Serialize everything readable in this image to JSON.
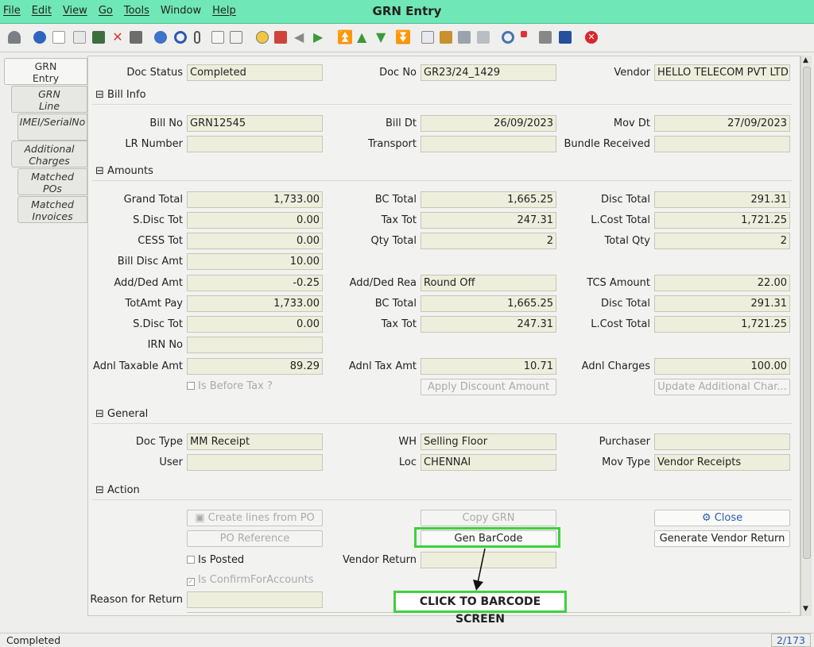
{
  "window": {
    "title": "GRN Entry"
  },
  "menu": [
    "File",
    "Edit",
    "View",
    "Go",
    "Tools",
    "Window",
    "Help"
  ],
  "toolbar_icons": [
    "undo-icon",
    "help-icon",
    "new-icon",
    "copy-icon",
    "save-new-icon",
    "delete-icon",
    "save-icon",
    "refresh-icon",
    "find-icon",
    "attach-icon",
    "chat-icon",
    "history-icon",
    "home-icon",
    "home-alt-icon",
    "back-icon",
    "forward-icon",
    "first-icon",
    "previous-icon",
    "next-icon",
    "last-icon",
    "report-icon",
    "archive-icon",
    "print-preview-icon",
    "print-icon",
    "zoom-across-icon",
    "workflow-icon",
    "request-icon",
    "product-info-icon",
    "exit-icon"
  ],
  "tabs": [
    {
      "label": "GRN\nEntry"
    },
    {
      "label": "GRN\nLine"
    },
    {
      "label": "IMEI/SerialNo"
    },
    {
      "label": "Additional\nCharges"
    },
    {
      "label": "Matched\nPOs"
    },
    {
      "label": "Matched\nInvoices"
    }
  ],
  "header": {
    "doc_status_label": "Doc Status",
    "doc_status": "Completed",
    "doc_no_label": "Doc No",
    "doc_no": "GR23/24_1429",
    "vendor_label": "Vendor",
    "vendor": "HELLO TELECOM PVT LTD"
  },
  "bill_info": {
    "section": "Bill Info",
    "bill_no_label": "Bill No",
    "bill_no": "GRN12545",
    "bill_dt_label": "Bill Dt",
    "bill_dt": "26/09/2023",
    "mov_dt_label": "Mov Dt",
    "mov_dt": "27/09/2023",
    "lr_label": "LR Number",
    "lr": "",
    "transport_label": "Transport",
    "transport": "",
    "bundle_label": "Bundle Received",
    "bundle": ""
  },
  "amounts": {
    "section": "Amounts",
    "grand_total_label": "Grand Total",
    "grand_total": "1,733.00",
    "bc_total_label": "BC Total",
    "bc_total": "1,665.25",
    "disc_total_label": "Disc Total",
    "disc_total": "291.31",
    "sdisc_tot_label": "S.Disc Tot",
    "sdisc_tot": "0.00",
    "tax_tot_label": "Tax Tot",
    "tax_tot": "247.31",
    "lcost_total_label": "L.Cost Total",
    "lcost_total": "1,721.25",
    "cess_tot_label": "CESS Tot",
    "cess_tot": "0.00",
    "qty_total_label": "Qty Total",
    "qty_total": "2",
    "total_qty_label": "Total Qty",
    "total_qty": "2",
    "bill_disc_amt_label": "Bill Disc Amt",
    "bill_disc_amt": "10.00",
    "add_ded_amt_label": "Add/Ded Amt",
    "add_ded_amt": "-0.25",
    "add_ded_rea_label": "Add/Ded Rea",
    "add_ded_rea": "Round Off",
    "tcs_amount_label": "TCS Amount",
    "tcs_amount": "22.00",
    "totamt_pay_label": "TotAmt Pay",
    "totamt_pay": "1,733.00",
    "bc_total2_label": "BC Total",
    "bc_total2": "1,665.25",
    "disc_total2_label": "Disc Total",
    "disc_total2": "291.31",
    "sdisc_tot2_label": "S.Disc Tot",
    "sdisc_tot2": "0.00",
    "tax_tot2_label": "Tax Tot",
    "tax_tot2": "247.31",
    "lcost_total2_label": "L.Cost Total",
    "lcost_total2": "1,721.25",
    "irn_no_label": "IRN No",
    "irn_no": "",
    "adnl_taxable_label": "Adnl Taxable Amt",
    "adnl_taxable": "89.29",
    "adnl_tax_label": "Adnl Tax Amt",
    "adnl_tax": "10.71",
    "adnl_charges_label": "Adnl Charges",
    "adnl_charges": "100.00",
    "is_before_tax_label": "Is Before Tax ?",
    "apply_discount_label": "Apply Discount Amount",
    "update_additional_label": "Update Additional Char..."
  },
  "general": {
    "section": "General",
    "doc_type_label": "Doc Type",
    "doc_type": "MM Receipt",
    "wh_label": "WH",
    "wh": "Selling Floor",
    "purchaser_label": "Purchaser",
    "purchaser": "",
    "user_label": "User",
    "user": "",
    "loc_label": "Loc",
    "loc": "CHENNAI",
    "mov_type_label": "Mov Type",
    "mov_type": "Vendor Receipts"
  },
  "action": {
    "section": "Action",
    "create_lines_label": "Create lines from PO",
    "copy_grn_label": "Copy GRN",
    "close_label": "Close",
    "po_reference_label": "PO Reference",
    "gen_barcode_label": "Gen BarCode",
    "gen_vendor_return_label": "Generate Vendor Return",
    "is_posted_label": "Is Posted",
    "vendor_return_label": "Vendor Return",
    "vendor_return": "",
    "is_confirm_label": "Is ConfirmForAccounts",
    "reason_label": "Reason for Return",
    "reason": ""
  },
  "callout": {
    "text": "CLICK TO BARCODE SCREEN"
  },
  "status": {
    "text": "Completed",
    "record": "2/173"
  },
  "colors": {
    "titlebar": "#6fe7b6",
    "field": "#eeeedd",
    "highlight": "#3ed13e"
  }
}
